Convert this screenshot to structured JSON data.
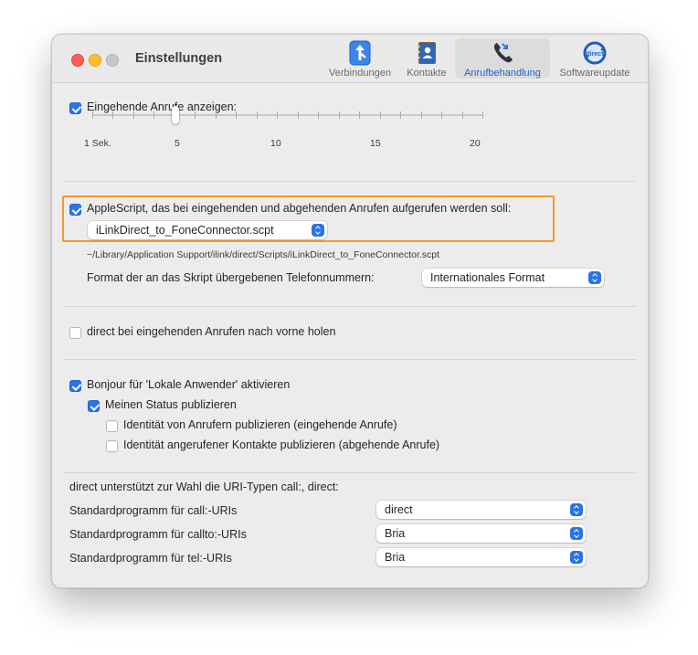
{
  "window": {
    "title": "Einstellungen"
  },
  "toolbar": {
    "items": [
      {
        "label": "Verbindungen",
        "icon": "connections-icon",
        "active": false
      },
      {
        "label": "Kontakte",
        "icon": "contacts-icon",
        "active": false
      },
      {
        "label": "Anrufbehandlung",
        "icon": "phone-handling-icon",
        "active": true
      },
      {
        "label": "Softwareupdate",
        "icon": "software-update-icon",
        "active": false
      }
    ]
  },
  "incoming": {
    "checkbox_label": "Eingehende Anrufe anzeigen:",
    "checked": true,
    "slider": {
      "value": 5,
      "min": 1,
      "max": 20,
      "tick_labels": [
        "1 Sek.",
        "5",
        "10",
        "15",
        "20"
      ]
    }
  },
  "applescript": {
    "checkbox_label": "AppleScript, das bei eingehenden und abgehenden Anrufen aufgerufen werden soll:",
    "checked": true,
    "script_popup": "iLinkDirect_to_FoneConnector.scpt",
    "path": "~/Library/Application Support/ilink/direct/Scripts/iLinkDirect_to_FoneConnector.scpt",
    "format_label": "Format der an das Skript übergebenen Telefonnummern:",
    "format_value": "Internationales Format",
    "highlight_color": "#f39a2a"
  },
  "bring_front": {
    "checkbox_label": "direct bei eingehenden Anrufen nach vorne holen",
    "checked": false
  },
  "bonjour": {
    "checkbox_label": "Bonjour für 'Lokale Anwender' aktivieren",
    "checked": true,
    "publish_status_label": "Meinen Status publizieren",
    "publish_status_checked": true,
    "caller_identity_label": "Identität von Anrufern publizieren (eingehende Anrufe)",
    "caller_identity_checked": false,
    "callee_identity_label": "Identität angerufener Kontakte publizieren (abgehende Anrufe)",
    "callee_identity_checked": false
  },
  "uri": {
    "intro": "direct unterstützt zur Wahl die URI-Typen call:, direct:",
    "rows": [
      {
        "label": "Standardprogramm für call:-URIs",
        "value": "direct"
      },
      {
        "label": "Standardprogramm für callto:-URIs",
        "value": "Bria"
      },
      {
        "label": "Standardprogramm für tel:-URIs",
        "value": "Bria"
      }
    ]
  },
  "colors": {
    "accent": "#2a73e8",
    "active_tab": "#2a63c7"
  }
}
